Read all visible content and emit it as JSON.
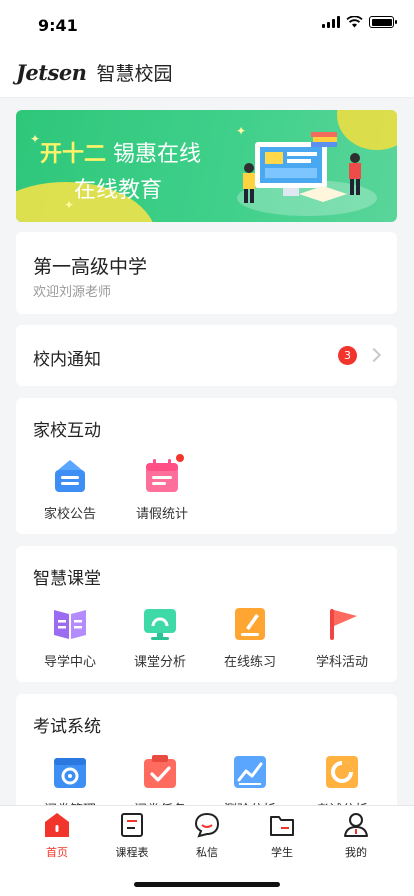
{
  "status_bar": {
    "time": "9:41"
  },
  "header": {
    "logo": "Jetsen",
    "title": "智慧校园"
  },
  "banner": {
    "highlight": "开十二",
    "line1_rest": " 锡惠在线",
    "line2": "在线教育"
  },
  "school": {
    "name": "第一高级中学",
    "welcome": "欢迎刘源老师"
  },
  "notice": {
    "label": "校内通知",
    "badge": "3"
  },
  "home_school": {
    "title": "家校互动",
    "items": [
      {
        "label": "家校公告",
        "icon": "announcement-icon"
      },
      {
        "label": "请假统计",
        "icon": "calendar-icon"
      }
    ]
  },
  "classroom": {
    "title": "智慧课堂",
    "items": [
      {
        "label": "导学中心",
        "icon": "book-icon"
      },
      {
        "label": "课堂分析",
        "icon": "monitor-icon"
      },
      {
        "label": "在线练习",
        "icon": "pencil-icon"
      },
      {
        "label": "学科活动",
        "icon": "flag-icon"
      }
    ]
  },
  "exam": {
    "title": "考试系统",
    "items": [
      {
        "label": "阅卷管理",
        "icon": "settings-box-icon"
      },
      {
        "label": "阅卷任务",
        "icon": "checklist-icon"
      },
      {
        "label": "测验分析",
        "icon": "line-chart-icon"
      },
      {
        "label": "考试分析",
        "icon": "pie-chart-icon"
      }
    ]
  },
  "tabs": [
    {
      "label": "首页",
      "icon": "home-icon",
      "active": true
    },
    {
      "label": "课程表",
      "icon": "schedule-icon",
      "active": false
    },
    {
      "label": "私信",
      "icon": "message-icon",
      "active": false
    },
    {
      "label": "学生",
      "icon": "folder-icon",
      "active": false
    },
    {
      "label": "我的",
      "icon": "profile-icon",
      "active": false
    }
  ],
  "colors": {
    "accent": "#f2352c",
    "banner_green": "#2ec77a",
    "background": "#f4f5f7"
  }
}
